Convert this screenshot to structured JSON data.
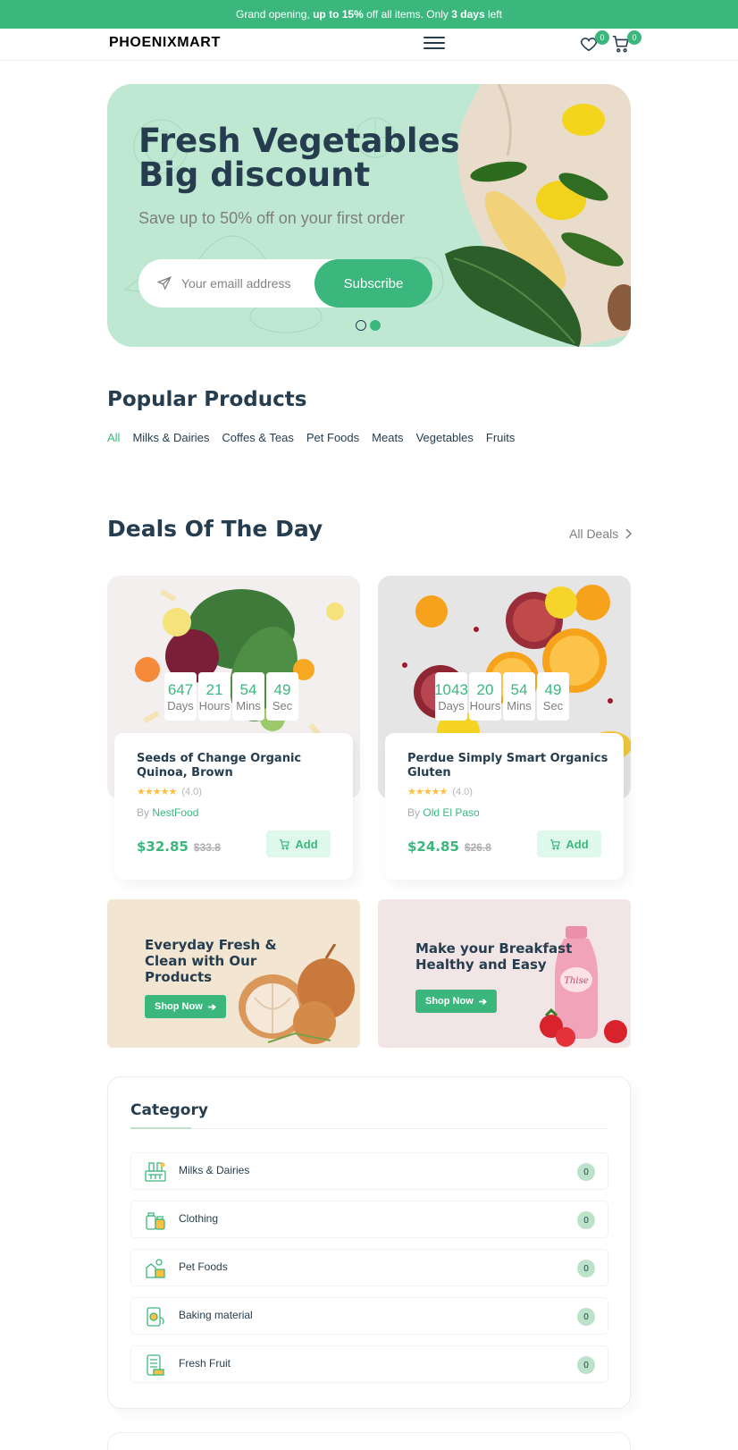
{
  "topbar": {
    "text_a": "Grand opening,",
    "text_b": "up to 15%",
    "text_c": "off all items. Only",
    "text_d": "3 days",
    "text_e": "left"
  },
  "header": {
    "logo": "PHOENIXMART",
    "wishlist_count": "0",
    "cart_count": "0"
  },
  "hero": {
    "title_line1": "Fresh Vegetables",
    "title_line2": "Big discount",
    "subtitle": "Save up to 50% off on your first order",
    "email_placeholder": "Your emaill address",
    "subscribe_label": "Subscribe",
    "active_slide": 2
  },
  "popular": {
    "title": "Popular Products",
    "filters": [
      "All",
      "Milks & Dairies",
      "Coffes & Teas",
      "Pet Foods",
      "Meats",
      "Vegetables",
      "Fruits"
    ],
    "active_filter": "All"
  },
  "deals": {
    "title": "Deals Of The Day",
    "all_label": "All Deals",
    "items": [
      {
        "days": "647",
        "hours": "21",
        "mins": "54",
        "secs": "49",
        "days_label": "Days",
        "hours_label": "Hours",
        "mins_label": "Mins",
        "secs_label": "Sec",
        "name_line1": "Seeds of Change Organic",
        "name_line2": "Quinoa, Brown",
        "rating": "(4.0)",
        "by": "By",
        "vendor": "NestFood",
        "price": "$32.85",
        "old_price": "$33.8",
        "add_label": "Add"
      },
      {
        "days": "1043",
        "hours": "20",
        "mins": "54",
        "secs": "49",
        "days_label": "Days",
        "hours_label": "Hours",
        "mins_label": "Mins",
        "secs_label": "Sec",
        "name_line1": "Perdue Simply Smart Organics",
        "name_line2": "Gluten",
        "rating": "(4.0)",
        "by": "By",
        "vendor": "Old El Paso",
        "price": "$24.85",
        "old_price": "$26.8",
        "add_label": "Add"
      }
    ]
  },
  "banners": [
    {
      "line1": "Everyday Fresh &",
      "line2": "Clean with Our",
      "line3": "Products",
      "button": "Shop Now"
    },
    {
      "line1": "Make your Breakfast",
      "line2": "Healthy and Easy",
      "button": "Shop Now",
      "bottle_text": "Thise"
    }
  ],
  "category": {
    "title": "Category",
    "items": [
      {
        "label": "Milks & Dairies",
        "count": "0"
      },
      {
        "label": "Clothing",
        "count": "0"
      },
      {
        "label": "Pet Foods",
        "count": "0"
      },
      {
        "label": "Baking material",
        "count": "0"
      },
      {
        "label": "Fresh Fruit",
        "count": "0"
      }
    ]
  },
  "colors": {
    "brand": "#3bb77e",
    "heading": "#253d4e",
    "hero_bg": "#bfe8d2",
    "banner1_bg": "#f2e6d2",
    "banner2_bg": "#f2e5e6"
  }
}
